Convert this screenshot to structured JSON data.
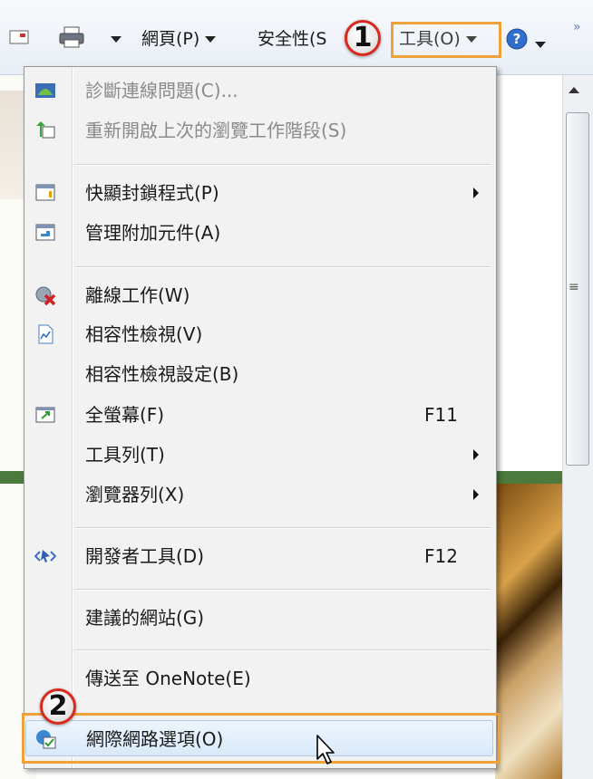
{
  "command_bar": {
    "page_label": "網頁(P)",
    "safety_label": "安全性(S",
    "tools_label": "工具(O)",
    "help_icon": "help-icon",
    "more_glyph": "»"
  },
  "callouts": {
    "step1": "1",
    "step2": "2"
  },
  "menu": {
    "items": [
      {
        "label": "診斷連線問題(C)...",
        "icon": "diagnose-connection-icon",
        "disabled": true
      },
      {
        "label": "重新開啟上次的瀏覽工作階段(S)",
        "icon": "reopen-session-icon",
        "disabled": true
      },
      {
        "label": "快顯封鎖程式(P)",
        "icon": "popup-blocker-icon",
        "submenu": true
      },
      {
        "label": "管理附加元件(A)",
        "icon": "manage-addons-icon"
      },
      {
        "label": "離線工作(W)",
        "icon": "work-offline-icon"
      },
      {
        "label": "相容性檢視(V)",
        "icon": "compatibility-view-icon"
      },
      {
        "label": "相容性檢視設定(B)"
      },
      {
        "label": "全螢幕(F)",
        "icon": "fullscreen-icon",
        "shortcut": "F11"
      },
      {
        "label": "工具列(T)",
        "submenu": true
      },
      {
        "label": "瀏覽器列(X)",
        "submenu": true
      },
      {
        "label": "開發者工具(D)",
        "icon": "developer-tools-icon",
        "shortcut": "F12"
      },
      {
        "label": "建議的網站(G)"
      },
      {
        "label": "傳送至 OneNote(E)"
      },
      {
        "label": "網際網路選項(O)",
        "icon": "internet-options-icon",
        "highlighted": true
      }
    ]
  },
  "colors": {
    "callout_border": "#f0a23a",
    "badge_ring": "#d9281c",
    "hover_fill": "#d9e9fa"
  }
}
